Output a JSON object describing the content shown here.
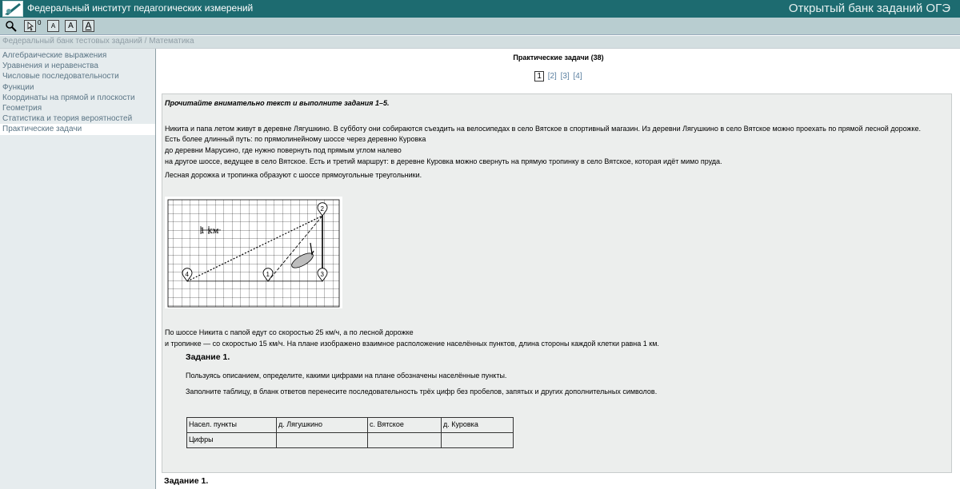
{
  "header": {
    "org_title": "Федеральный институт педагогических измерений",
    "bank_title": "Открытый банк заданий ОГЭ"
  },
  "toolbar": {
    "zoom_icon": "magnifier-icon",
    "cursor_counter": "0",
    "font_small": "A",
    "font_medium": "A",
    "font_large": "A"
  },
  "breadcrumb": "Федеральный банк тестовых заданий / Математика",
  "sidebar": {
    "items": [
      {
        "label": "Алгебраические выражения"
      },
      {
        "label": "Уравнения и неравенства"
      },
      {
        "label": "Числовые последовательности"
      },
      {
        "label": "Функции"
      },
      {
        "label": "Координаты на прямой и плоскости"
      },
      {
        "label": "Геометрия"
      },
      {
        "label": "Статистика и теория вероятностей"
      },
      {
        "label": "Практические задачи",
        "selected": true
      }
    ]
  },
  "main": {
    "title": "Практические задачи (38)",
    "pages": [
      "1",
      "[2]",
      "[3]",
      "[4]"
    ],
    "current_page": "1",
    "task": {
      "intro_title": "Прочитайте внимательно текст и выполните задания 1–5.",
      "para_lines": [
        "Никита и папа летом живут в деревне Лягушкино. В субботу они собираются съездить на велосипедах в село Вятское в спортивный магазин. Из деревни Лягушкино в село Вятское можно проехать по прямой лесной дорожке.",
        "Есть более длинный путь: по прямолинейному шоссе через деревню Куровка",
        "до деревни Марусино, где нужно повернуть под прямым углом налево",
        "на другое шоссе, ведущее в село Вятское. Есть и третий маршрут: в деревне Куровка можно свернуть на прямую тропинку в село Вятское, которая идёт мимо пруда.",
        "Лесная дорожка и тропинка образуют с шоссе прямоугольные треугольники."
      ],
      "map": {
        "scale_label": "1 км",
        "points": [
          "1",
          "2",
          "3",
          "4"
        ]
      },
      "speed_lines": [
        "По шоссе Никита с папой едут со скоростью 25 км/ч, а по лесной дорожке",
        "и тропинке — со скоростью 15 км/ч. На плане изображено взаимное расположение населённых пунктов, длина стороны каждой клетки равна 1 км."
      ],
      "subtask_title": "Задание 1.",
      "subtask_text_1": "Пользуясь описанием, определите, какими цифрами на плане обозначены населённые пункты.",
      "subtask_text_2": "Заполните таблицу, в бланк ответов перенесите последовательность трёх цифр без пробелов, запятых и других дополнительных символов.",
      "table": {
        "header": [
          "Насел. пункты",
          "д. Лягушкино",
          "с. Вятское",
          "д. Куровка"
        ],
        "row_label": "Цифры"
      },
      "next_title": "Задание 1."
    }
  }
}
